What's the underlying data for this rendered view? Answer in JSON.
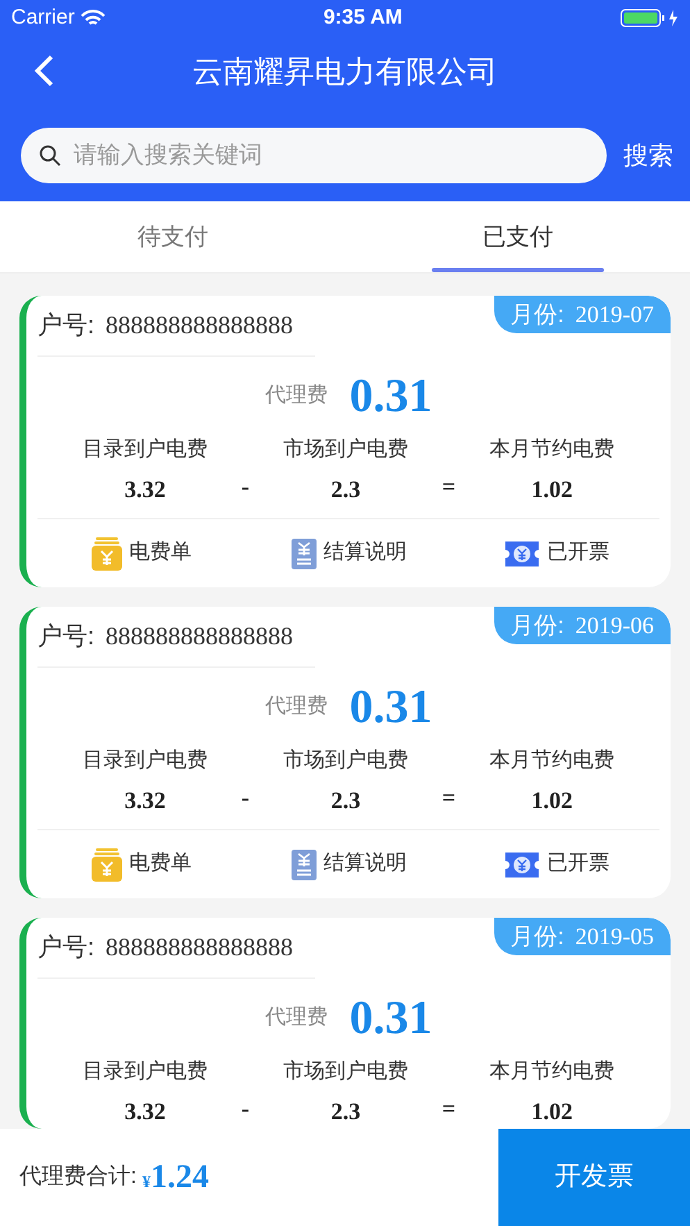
{
  "status_bar": {
    "carrier": "Carrier",
    "time": "9:35 AM"
  },
  "nav": {
    "title": "云南耀昇电力有限公司"
  },
  "search": {
    "placeholder": "请输入搜索关键词",
    "button": "搜索"
  },
  "tabs": [
    {
      "label": "待支付",
      "selected": false
    },
    {
      "label": "已支付",
      "selected": true
    }
  ],
  "cards": [
    {
      "account_label": "户号:",
      "account": "888888888888888",
      "month_label": "月份:",
      "month": "2019-07",
      "fee_label": "代理费",
      "fee": "0.31",
      "items": [
        {
          "label": "目录到户电费",
          "value": "3.32"
        },
        {
          "label": "市场到户电费",
          "value": "2.3"
        },
        {
          "label": "本月节约电费",
          "value": "1.02"
        }
      ],
      "operators": [
        "-",
        "="
      ],
      "actions": [
        {
          "kind": "bill",
          "label": "电费单"
        },
        {
          "kind": "doc",
          "label": "结算说明"
        },
        {
          "kind": "ticket",
          "label": "已开票"
        }
      ]
    },
    {
      "account_label": "户号:",
      "account": "888888888888888",
      "month_label": "月份:",
      "month": "2019-06",
      "fee_label": "代理费",
      "fee": "0.31",
      "items": [
        {
          "label": "目录到户电费",
          "value": "3.32"
        },
        {
          "label": "市场到户电费",
          "value": "2.3"
        },
        {
          "label": "本月节约电费",
          "value": "1.02"
        }
      ],
      "operators": [
        "-",
        "="
      ],
      "actions": [
        {
          "kind": "bill",
          "label": "电费单"
        },
        {
          "kind": "doc",
          "label": "结算说明"
        },
        {
          "kind": "ticket",
          "label": "已开票"
        }
      ]
    },
    {
      "account_label": "户号:",
      "account": "888888888888888",
      "month_label": "月份:",
      "month": "2019-05",
      "fee_label": "代理费",
      "fee": "0.31",
      "items": [
        {
          "label": "目录到户电费",
          "value": "3.32"
        },
        {
          "label": "市场到户电费",
          "value": "2.3"
        },
        {
          "label": "本月节约电费",
          "value": "1.02"
        }
      ],
      "operators": [
        "-",
        "="
      ]
    }
  ],
  "footer": {
    "total_label": "代理费合计:",
    "currency": "¥",
    "total": "1.24",
    "button": "开发票"
  }
}
